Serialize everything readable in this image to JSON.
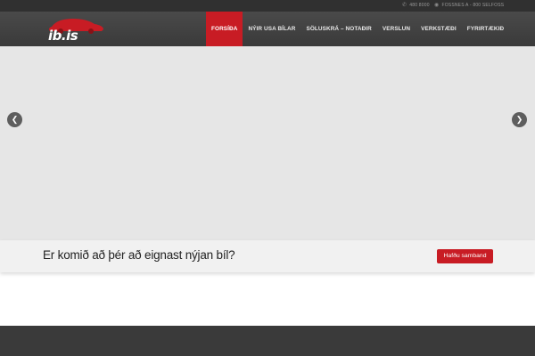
{
  "topbar": {
    "phone": "480 8000",
    "address": "FOSSNES A - 800 SELFOSS"
  },
  "logo": {
    "text": "ib.is",
    "colors": {
      "car": "#c81c24",
      "text": "#ffffff"
    }
  },
  "nav": {
    "items": [
      {
        "label": "FORSÍÐA",
        "active": true
      },
      {
        "label": "NÝIR USA BÍLAR",
        "active": false
      },
      {
        "label": "SÖLUSKRÁ – NOTAÐIR",
        "active": false
      },
      {
        "label": "VERSLUN",
        "active": false
      },
      {
        "label": "VERKSTÆÐI",
        "active": false
      },
      {
        "label": "FYRIRTÆKIÐ",
        "active": false
      }
    ]
  },
  "slider": {
    "prev_icon": "chevron-left-icon",
    "next_icon": "chevron-right-icon"
  },
  "cta": {
    "text": "Er komið að þér að eignast nýjan bíl?",
    "button_label": "Hafðu samband"
  },
  "colors": {
    "accent": "#c81c24",
    "topbar": "#303030",
    "navbar": "#404040",
    "slider": "#e6e6e6",
    "footer": "#3a3a3a"
  }
}
